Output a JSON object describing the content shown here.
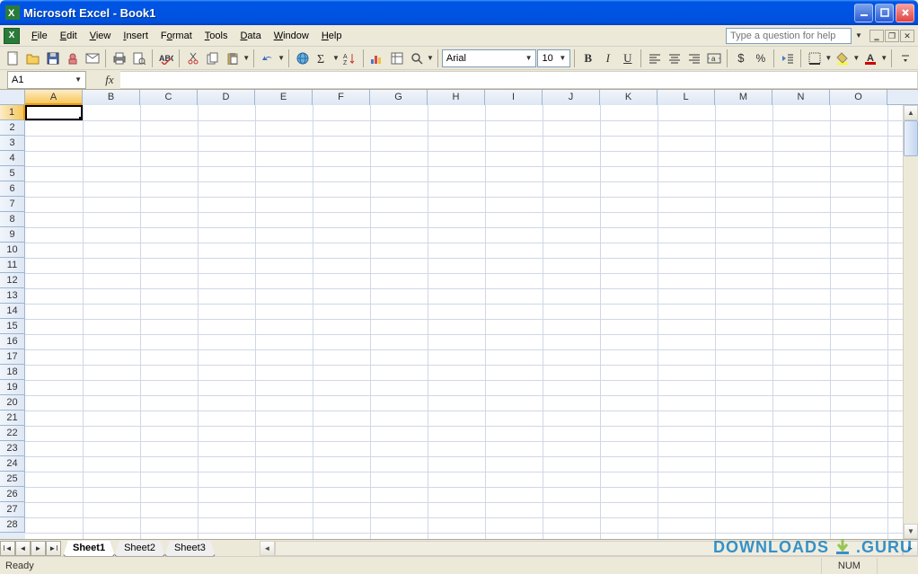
{
  "window": {
    "title": "Microsoft Excel - Book1"
  },
  "menu": {
    "items": [
      "File",
      "Edit",
      "View",
      "Insert",
      "Format",
      "Tools",
      "Data",
      "Window",
      "Help"
    ],
    "ask_placeholder": "Type a question for help"
  },
  "toolbar": {
    "font_name": "Arial",
    "font_size": "10"
  },
  "formula": {
    "name_box": "A1",
    "formula": ""
  },
  "grid": {
    "columns": [
      "A",
      "B",
      "C",
      "D",
      "E",
      "F",
      "G",
      "H",
      "I",
      "J",
      "K",
      "L",
      "M",
      "N",
      "O"
    ],
    "row_count": 28,
    "selected_cell": "A1",
    "selected_col": "A",
    "selected_row": 1
  },
  "sheets": {
    "tabs": [
      "Sheet1",
      "Sheet2",
      "Sheet3"
    ],
    "active": "Sheet1"
  },
  "status": {
    "mode": "Ready",
    "num": "NUM"
  },
  "watermark": {
    "a": "DOWNLOADS",
    "b": ".GURU"
  }
}
